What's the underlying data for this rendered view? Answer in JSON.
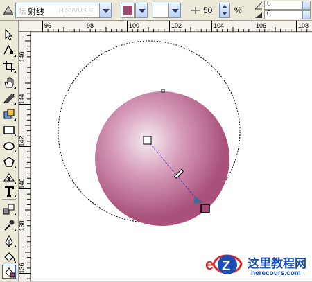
{
  "propbar": {
    "fill_type_value": "射线",
    "faint_text": "HISSVUSHE",
    "faint_text_cn": "坛",
    "start_color": "#9b4a70",
    "end_color": "#ffffff",
    "midpoint_value": "50",
    "percent_sign": "%",
    "angle_value": "0",
    "edge_value": "0"
  },
  "hruler": {
    "labels": [
      "96",
      "98",
      "100",
      "102",
      "104",
      "106",
      "108"
    ]
  },
  "vruler": {
    "labels": [
      "146",
      "144",
      "142",
      "140",
      "138",
      "136"
    ]
  },
  "colors": {
    "sphere_light": "#f6ecf2",
    "sphere_mid": "#d69bb9",
    "sphere_dark": "#a9517b",
    "handle_end": "#a54b74",
    "accent_blue": "#1b4fb5",
    "accent_red": "#e02a2a"
  },
  "watermark": {
    "title": "这里教程网",
    "subtitle": "herecours.com"
  }
}
